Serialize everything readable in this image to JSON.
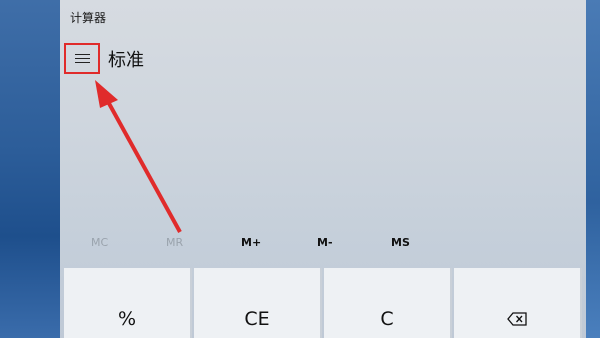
{
  "window": {
    "title": "计算器"
  },
  "header": {
    "mode_title": "标准",
    "menu_icon": "hamburger-icon"
  },
  "memory": {
    "buttons": [
      {
        "label": "MC",
        "enabled": false
      },
      {
        "label": "MR",
        "enabled": false
      },
      {
        "label": "M+",
        "enabled": true
      },
      {
        "label": "M-",
        "enabled": true
      },
      {
        "label": "MS",
        "enabled": true
      }
    ]
  },
  "keys": [
    {
      "label": "%"
    },
    {
      "label": "CE"
    },
    {
      "label": "C"
    },
    {
      "label": "",
      "icon": "backspace-icon"
    }
  ],
  "annotation": {
    "color": "#e02b2b"
  }
}
